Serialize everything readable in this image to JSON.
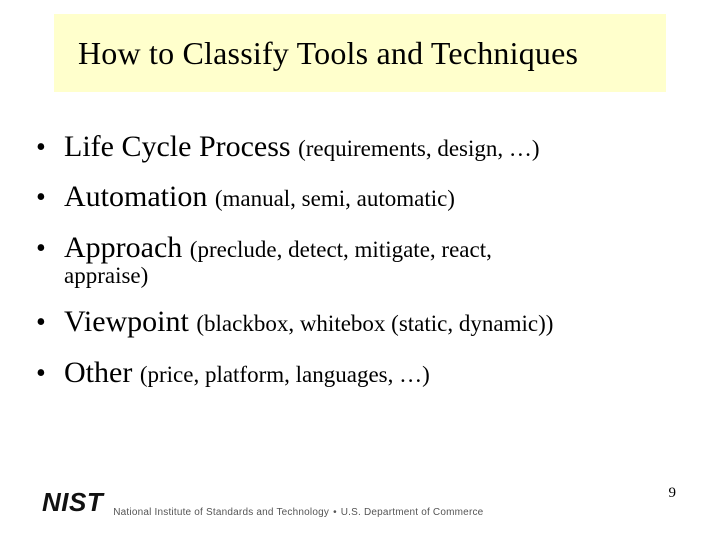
{
  "title": "How to Classify Tools and Techniques",
  "bullets": [
    {
      "main": "Life Cycle Process ",
      "paren": "(requirements, design, …)",
      "cont": ""
    },
    {
      "main": "Automation ",
      "paren": "(manual, semi, automatic)",
      "cont": ""
    },
    {
      "main": "Approach ",
      "paren": "(preclude, detect, mitigate, react, ",
      "cont": "appraise)"
    },
    {
      "main": "Viewpoint ",
      "paren": "(blackbox, whitebox (static, dynamic))",
      "cont": ""
    },
    {
      "main": "Other ",
      "paren": "(price, platform, languages, …)",
      "cont": ""
    }
  ],
  "footer": {
    "logo_text": "NIST",
    "org": "National Institute of Standards and Technology",
    "dept": "U.S. Department of Commerce"
  },
  "page_number": "9"
}
